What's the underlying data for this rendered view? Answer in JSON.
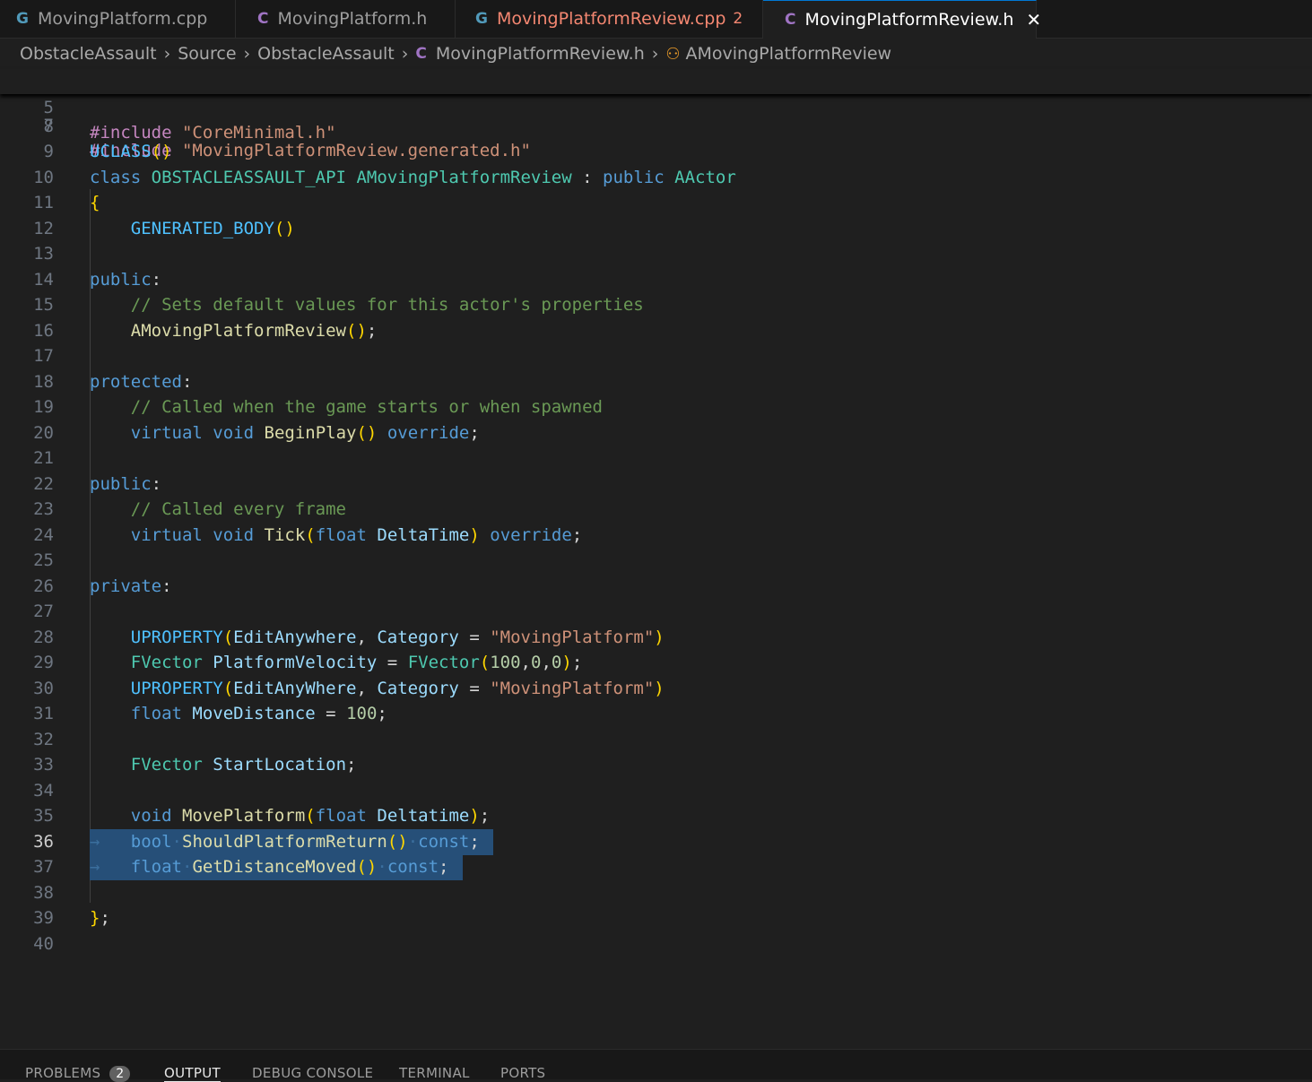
{
  "tabs": [
    {
      "label": "MovingPlatform.cpp",
      "icon": "cpp-file-icon",
      "badge": "",
      "active": false
    },
    {
      "label": "MovingPlatform.h",
      "icon": "c-header-icon",
      "badge": "",
      "active": false
    },
    {
      "label": "MovingPlatformReview.cpp",
      "icon": "cpp-file-icon",
      "badge": "2",
      "active": false
    },
    {
      "label": "MovingPlatformReview.h",
      "icon": "c-header-icon",
      "badge": "",
      "active": true
    }
  ],
  "icons": {
    "cpp": "G",
    "h": "C",
    "close": "✕",
    "chevron": "›",
    "symbol": "⚇"
  },
  "breadcrumb": {
    "items": [
      "ObstacleAssault",
      "Source",
      "ObstacleAssault",
      "MovingPlatformReview.h",
      "AMovingPlatformReview"
    ]
  },
  "editor": {
    "sticky_line": {
      "number": "5",
      "text": "#include \"CoreMinimal.h\""
    },
    "peek_line": {
      "number": "7",
      "text": "#include \"MovingPlatformReview.generated.h\""
    },
    "current_line": "36",
    "lines": [
      {
        "n": "8",
        "t": ""
      },
      {
        "n": "9",
        "t": "UCLASS()"
      },
      {
        "n": "10",
        "t": "class OBSTACLEASSAULT_API AMovingPlatformReview : public AActor"
      },
      {
        "n": "11",
        "t": "{"
      },
      {
        "n": "12",
        "t": "    GENERATED_BODY()"
      },
      {
        "n": "13",
        "t": ""
      },
      {
        "n": "14",
        "t": "public:"
      },
      {
        "n": "15",
        "t": "    // Sets default values for this actor's properties"
      },
      {
        "n": "16",
        "t": "    AMovingPlatformReview();"
      },
      {
        "n": "17",
        "t": ""
      },
      {
        "n": "18",
        "t": "protected:"
      },
      {
        "n": "19",
        "t": "    // Called when the game starts or when spawned"
      },
      {
        "n": "20",
        "t": "    virtual void BeginPlay() override;"
      },
      {
        "n": "21",
        "t": ""
      },
      {
        "n": "22",
        "t": "public:"
      },
      {
        "n": "23",
        "t": "    // Called every frame"
      },
      {
        "n": "24",
        "t": "    virtual void Tick(float DeltaTime) override;"
      },
      {
        "n": "25",
        "t": ""
      },
      {
        "n": "26",
        "t": "private:"
      },
      {
        "n": "27",
        "t": ""
      },
      {
        "n": "28",
        "t": "    UPROPERTY(EditAnywhere, Category = \"MovingPlatform\")"
      },
      {
        "n": "29",
        "t": "    FVector PlatformVelocity = FVector(100,0,0);"
      },
      {
        "n": "30",
        "t": "    UPROPERTY(EditAnyWhere, Category = \"MovingPlatform\")"
      },
      {
        "n": "31",
        "t": "    float MoveDistance = 100;"
      },
      {
        "n": "32",
        "t": ""
      },
      {
        "n": "33",
        "t": "    FVector StartLocation;"
      },
      {
        "n": "34",
        "t": ""
      },
      {
        "n": "35",
        "t": "    void MovePlatform(float Deltatime);"
      },
      {
        "n": "36",
        "t": "    bool ShouldPlatformReturn() const;"
      },
      {
        "n": "37",
        "t": "    float GetDistanceMoved() const;"
      },
      {
        "n": "38",
        "t": ""
      },
      {
        "n": "39",
        "t": "};"
      },
      {
        "n": "40",
        "t": ""
      }
    ]
  },
  "panel": {
    "tabs": [
      {
        "label": "PROBLEMS",
        "badge": "2"
      },
      {
        "label": "OUTPUT"
      },
      {
        "label": "DEBUG CONSOLE"
      },
      {
        "label": "TERMINAL"
      },
      {
        "label": "PORTS"
      }
    ]
  },
  "colors": {
    "background": "#1f1f1f",
    "keyword": "#569cd6",
    "string": "#ce9178",
    "comment": "#6a9955",
    "type": "#4ec9b0",
    "function": "#dcdcaa",
    "variable": "#9cdcfe",
    "selection": "#264f78",
    "error": "#f48771"
  }
}
